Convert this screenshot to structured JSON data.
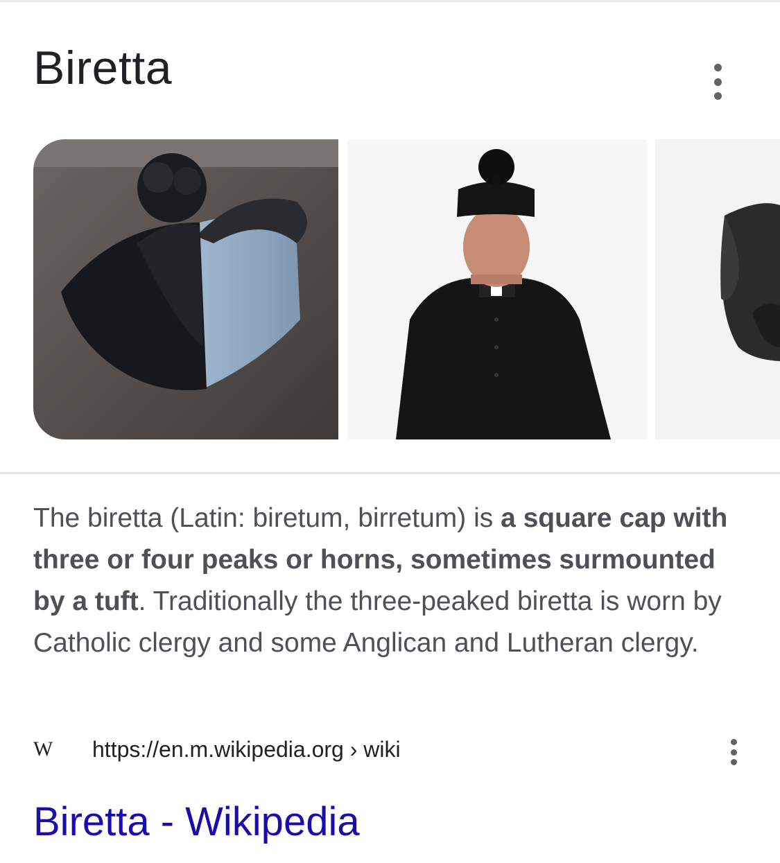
{
  "header": {
    "title": "Biretta"
  },
  "gallery": {
    "images": [
      {
        "name": "biretta-on-table"
      },
      {
        "name": "priest-wearing-biretta"
      },
      {
        "name": "biretta-partial"
      }
    ]
  },
  "description": {
    "intro": "The biretta (Latin: biretum, birretum) is ",
    "bold": "a square cap with three or four peaks or horns, sometimes surmounted by a tuft",
    "outro": ". Traditionally the three-peaked biretta is worn by Catholic clergy and some Anglican and Lutheran clergy."
  },
  "source": {
    "logo": "W",
    "url": "https://en.m.wikipedia.org",
    "separator": "›",
    "path": "wiki"
  },
  "result": {
    "link": "Biretta - Wikipedia"
  }
}
